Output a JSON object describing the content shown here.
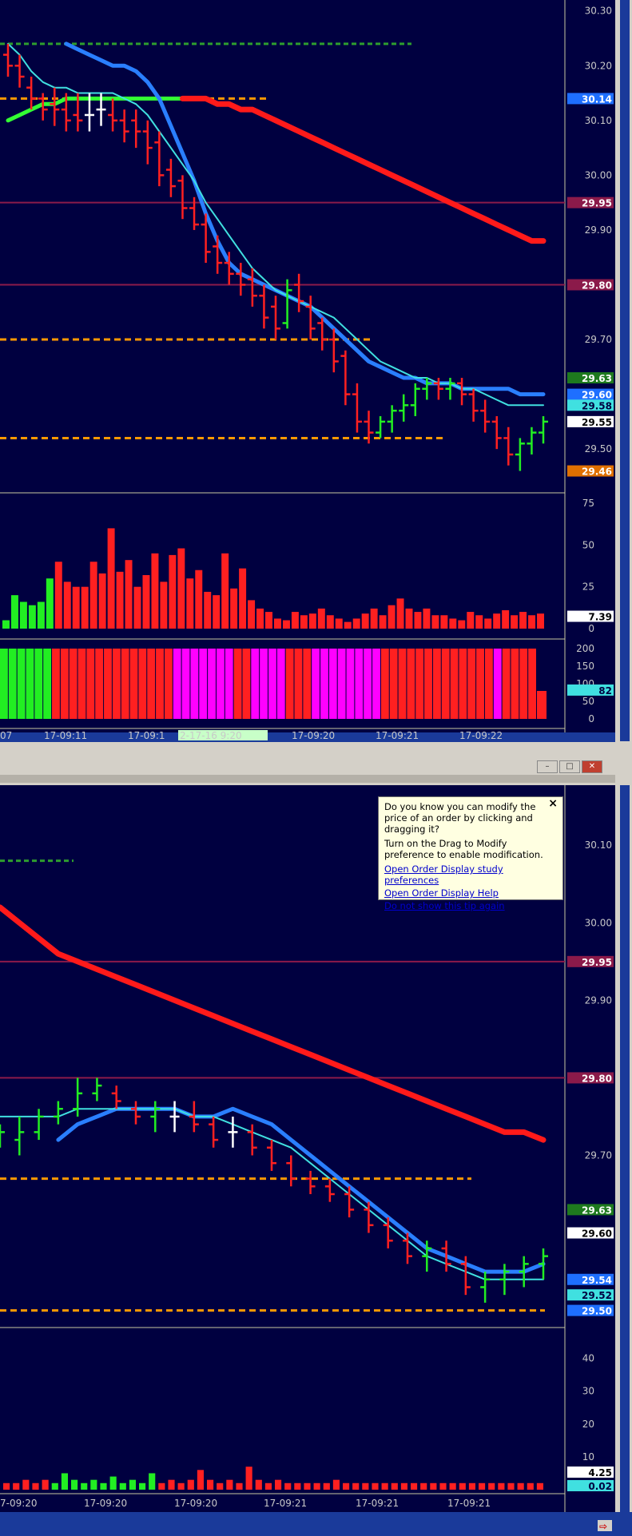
{
  "colors": {
    "background": "#000040",
    "up_bar": "#22ee22",
    "down_bar": "#ff2020",
    "doji_bar": "#ffffff",
    "ema_fast": "#40e0e0",
    "ema_slow": "#2a7fff",
    "ma_red": "#ff1a1a",
    "ma_green": "#33ff33",
    "level_line": "#8b1a4a",
    "order_line": "#ff9900",
    "target_line": "#2e9e2e",
    "magenta": "#ff00ff"
  },
  "top_chart": {
    "price_labels": [
      "30.30",
      "30.20",
      "30.10",
      "30.00",
      "29.90",
      "29.70",
      "29.50"
    ],
    "tags": [
      {
        "text": "30.14",
        "bg": "#1e6fff",
        "fg": "#ffffff"
      },
      {
        "text": "29.95",
        "bg": "#8b1a4a",
        "fg": "#ffffff"
      },
      {
        "text": "29.80",
        "bg": "#8b1a4a",
        "fg": "#ffffff"
      },
      {
        "text": "29.63",
        "bg": "#1e7a1e",
        "fg": "#ffffff"
      },
      {
        "text": "29.60",
        "bg": "#1e6fff",
        "fg": "#ffffff"
      },
      {
        "text": "29.58",
        "bg": "#40e0e0",
        "fg": "#000040"
      },
      {
        "text": "29.55",
        "bg": "#ffffff",
        "fg": "#000000"
      },
      {
        "text": "29.46",
        "bg": "#e07000",
        "fg": "#ffffff"
      }
    ],
    "volume_labels": [
      "75",
      "50",
      "25",
      "0"
    ],
    "volume_tag": "7.39",
    "indicator_labels": [
      "200",
      "150",
      "100",
      "50",
      "0"
    ],
    "indicator_tag": "82",
    "time_labels": [
      "07",
      "17-09:11",
      "17-09:1",
      "2-17-16  9:20",
      "17-09:20",
      "17-09:21",
      "17-09:22"
    ]
  },
  "bottom_chart": {
    "price_labels": [
      "30.10",
      "30.00",
      "29.90",
      "29.70"
    ],
    "tags": [
      {
        "text": "29.95",
        "bg": "#8b1a4a",
        "fg": "#ffffff"
      },
      {
        "text": "29.80",
        "bg": "#8b1a4a",
        "fg": "#ffffff"
      },
      {
        "text": "29.63",
        "bg": "#1e7a1e",
        "fg": "#ffffff"
      },
      {
        "text": "29.60",
        "bg": "#ffffff",
        "fg": "#000000"
      },
      {
        "text": "29.54",
        "bg": "#1e6fff",
        "fg": "#ffffff"
      },
      {
        "text": "29.52",
        "bg": "#40e0e0",
        "fg": "#000040"
      },
      {
        "text": "29.50",
        "bg": "#1e6fff",
        "fg": "#ffffff"
      }
    ],
    "volume_labels": [
      "40",
      "30",
      "20",
      "10"
    ],
    "volume_tags": [
      "4.25",
      "0.02"
    ],
    "time_labels": [
      "7-09:20",
      "17-09:20",
      "17-09:20",
      "17-09:21",
      "17-09:21",
      "17-09:21"
    ]
  },
  "tooltip": {
    "close": "×",
    "text1": "Do you know you can modify the price of an order by clicking and dragging it?",
    "text2": "Turn on the Drag to Modify preference to enable modification.",
    "link1": "Open Order Display study preferences",
    "link2": "Open Order Display Help",
    "link3": "Do not show this tip again"
  },
  "window_buttons": [
    "–",
    "□",
    "✕"
  ],
  "chart_data": [
    {
      "type": "bar",
      "title": "",
      "ylim": [
        29.42,
        30.32
      ],
      "series": [
        {
          "ohlc": [
            [
              30.22,
              30.24,
              30.18,
              30.2
            ],
            [
              30.2,
              30.22,
              30.16,
              30.18
            ],
            [
              30.16,
              30.18,
              30.12,
              30.14
            ],
            [
              30.14,
              30.15,
              30.1,
              30.12
            ],
            [
              30.13,
              30.16,
              30.09,
              30.12
            ],
            [
              30.12,
              30.15,
              30.08,
              30.1
            ],
            [
              30.11,
              30.15,
              30.08,
              30.1
            ],
            [
              30.11,
              30.15,
              30.08,
              30.11
            ],
            [
              30.12,
              30.15,
              30.09,
              30.12
            ],
            [
              30.11,
              30.14,
              30.08,
              30.1
            ],
            [
              30.1,
              30.12,
              30.06,
              30.08
            ],
            [
              30.1,
              30.12,
              30.05,
              30.08
            ],
            [
              30.08,
              30.1,
              30.02,
              30.05
            ],
            [
              30.06,
              30.08,
              29.98,
              30.0
            ],
            [
              30.01,
              30.03,
              29.96,
              29.98
            ],
            [
              29.99,
              30.0,
              29.92,
              29.94
            ],
            [
              29.94,
              29.96,
              29.9,
              29.91
            ],
            [
              29.91,
              29.93,
              29.84,
              29.86
            ],
            [
              29.87,
              29.89,
              29.82,
              29.84
            ],
            [
              29.84,
              29.86,
              29.8,
              29.82
            ],
            [
              29.82,
              29.84,
              29.78,
              29.8
            ],
            [
              29.81,
              29.83,
              29.76,
              29.78
            ],
            [
              29.78,
              29.8,
              29.72,
              29.74
            ],
            [
              29.76,
              29.78,
              29.7,
              29.72
            ],
            [
              29.73,
              29.81,
              29.72,
              29.79
            ],
            [
              29.8,
              29.82,
              29.75,
              29.77
            ],
            [
              29.76,
              29.78,
              29.7,
              29.72
            ],
            [
              29.73,
              29.74,
              29.68,
              29.7
            ],
            [
              29.7,
              29.72,
              29.64,
              29.66
            ],
            [
              29.67,
              29.68,
              29.58,
              29.6
            ],
            [
              29.6,
              29.62,
              29.53,
              29.55
            ],
            [
              29.55,
              29.57,
              29.51,
              29.53
            ],
            [
              29.53,
              29.56,
              29.52,
              29.55
            ],
            [
              29.55,
              29.58,
              29.53,
              29.57
            ],
            [
              29.57,
              29.6,
              29.55,
              29.58
            ],
            [
              29.58,
              29.62,
              29.56,
              29.61
            ],
            [
              29.61,
              29.63,
              29.59,
              29.62
            ],
            [
              29.62,
              29.63,
              29.59,
              29.61
            ],
            [
              29.61,
              29.63,
              29.59,
              29.62
            ],
            [
              29.62,
              29.63,
              29.58,
              29.6
            ],
            [
              29.6,
              29.61,
              29.55,
              29.57
            ],
            [
              29.57,
              29.59,
              29.53,
              29.55
            ],
            [
              29.55,
              29.56,
              29.5,
              29.52
            ],
            [
              29.52,
              29.54,
              29.47,
              29.49
            ],
            [
              29.49,
              29.52,
              29.46,
              29.51
            ],
            [
              29.51,
              29.54,
              29.49,
              29.53
            ],
            [
              29.53,
              29.56,
              29.51,
              29.55
            ]
          ],
          "ema_fast": [
            30.24,
            30.22,
            30.19,
            30.17,
            30.16,
            30.16,
            30.15,
            30.15,
            30.15,
            30.15,
            30.14,
            30.13,
            30.11,
            30.08,
            30.05,
            30.02,
            29.99,
            29.95,
            29.92,
            29.89,
            29.86,
            29.83,
            29.81,
            29.79,
            29.78,
            29.77,
            29.76,
            29.75,
            29.74,
            29.72,
            29.7,
            29.68,
            29.66,
            29.65,
            29.64,
            29.63,
            29.63,
            29.62,
            29.62,
            29.61,
            29.61,
            29.6,
            29.59,
            29.58,
            29.58,
            29.58,
            29.58
          ],
          "ema_slow": [
            null,
            null,
            null,
            null,
            null,
            30.24,
            30.23,
            30.22,
            30.21,
            30.2,
            30.2,
            30.19,
            30.17,
            30.14,
            30.09,
            30.04,
            29.99,
            29.93,
            29.88,
            29.84,
            29.82,
            29.81,
            29.8,
            29.79,
            29.78,
            29.77,
            29.76,
            29.74,
            29.72,
            29.7,
            29.68,
            29.66,
            29.65,
            29.64,
            29.63,
            29.63,
            29.62,
            29.62,
            29.62,
            29.61,
            29.61,
            29.61,
            29.61,
            29.61,
            29.6,
            29.6,
            29.6
          ],
          "ma_red": [
            null,
            null,
            null,
            null,
            null,
            null,
            null,
            null,
            null,
            null,
            null,
            null,
            null,
            null,
            null,
            30.14,
            30.14,
            30.14,
            30.13,
            30.13,
            30.12,
            30.12,
            30.11,
            30.1,
            30.09,
            30.08,
            30.07,
            30.06,
            30.05,
            30.04,
            30.03,
            30.02,
            30.01,
            30.0,
            29.99,
            29.98,
            29.97,
            29.96,
            29.95,
            29.94,
            29.93,
            29.92,
            29.91,
            29.9,
            29.89,
            29.88,
            29.88
          ],
          "ma_green": [
            30.1,
            30.11,
            30.12,
            30.13,
            30.13,
            30.14,
            30.14,
            30.14,
            30.14,
            30.14,
            30.14,
            30.14,
            30.14,
            30.14,
            30.14,
            30.14
          ]
        }
      ],
      "volume": [
        5,
        20,
        16,
        14,
        16,
        30,
        40,
        28,
        25,
        25,
        40,
        33,
        60,
        34,
        41,
        25,
        32,
        45,
        28,
        44,
        48,
        30,
        35,
        22,
        20,
        45,
        24,
        36,
        17,
        12,
        10,
        6,
        5,
        10,
        8,
        9,
        12,
        8,
        6,
        4,
        6,
        9,
        12,
        8,
        14,
        18,
        12,
        10,
        12,
        8,
        8,
        6,
        5,
        10,
        8,
        6,
        9,
        11,
        8,
        10,
        8,
        9
      ],
      "indicator_colors": [
        "g",
        "g",
        "g",
        "g",
        "g",
        "g",
        "r",
        "r",
        "r",
        "r",
        "r",
        "r",
        "r",
        "r",
        "r",
        "r",
        "r",
        "r",
        "r",
        "r",
        "m",
        "m",
        "m",
        "m",
        "m",
        "m",
        "m",
        "r",
        "r",
        "m",
        "m",
        "m",
        "m",
        "r",
        "r",
        "r",
        "m",
        "m",
        "m",
        "m",
        "m",
        "m",
        "m",
        "m",
        "r",
        "r",
        "r",
        "r",
        "r",
        "r",
        "r",
        "r",
        "r",
        "r",
        "r",
        "r",
        "r",
        "m",
        "r",
        "r",
        "r",
        "r"
      ]
    },
    {
      "type": "bar",
      "title": "",
      "ylim": [
        29.48,
        30.16
      ],
      "series": [
        {
          "ohlc": [
            [
              29.72,
              29.74,
              29.71,
              29.73
            ],
            [
              29.72,
              29.75,
              29.7,
              29.73
            ],
            [
              29.73,
              29.76,
              29.72,
              29.75
            ],
            [
              29.75,
              29.77,
              29.74,
              29.76
            ],
            [
              29.76,
              29.8,
              29.75,
              29.78
            ],
            [
              29.78,
              29.8,
              29.77,
              29.79
            ],
            [
              29.78,
              29.79,
              29.76,
              29.77
            ],
            [
              29.76,
              29.77,
              29.74,
              29.75
            ],
            [
              29.75,
              29.77,
              29.73,
              29.76
            ],
            [
              29.75,
              29.77,
              29.73,
              29.75
            ],
            [
              29.75,
              29.77,
              29.73,
              29.74
            ],
            [
              29.74,
              29.75,
              29.71,
              29.72
            ],
            [
              29.73,
              29.75,
              29.71,
              29.73
            ],
            [
              29.73,
              29.74,
              29.7,
              29.71
            ],
            [
              29.71,
              29.72,
              29.68,
              29.69
            ],
            [
              29.69,
              29.7,
              29.66,
              29.67
            ],
            [
              29.67,
              29.68,
              29.65,
              29.66
            ],
            [
              29.66,
              29.67,
              29.64,
              29.65
            ],
            [
              29.65,
              29.66,
              29.62,
              29.63
            ],
            [
              29.63,
              29.64,
              29.6,
              29.61
            ],
            [
              29.61,
              29.62,
              29.58,
              29.59
            ],
            [
              29.59,
              29.6,
              29.56,
              29.57
            ],
            [
              29.57,
              29.59,
              29.55,
              29.58
            ],
            [
              29.58,
              29.59,
              29.55,
              29.56
            ],
            [
              29.56,
              29.57,
              29.52,
              29.53
            ],
            [
              29.53,
              29.55,
              29.51,
              29.54
            ],
            [
              29.54,
              29.56,
              29.52,
              29.55
            ],
            [
              29.55,
              29.57,
              29.53,
              29.56
            ],
            [
              29.56,
              29.58,
              29.54,
              29.57
            ]
          ],
          "ema_fast": [
            29.75,
            29.75,
            29.75,
            29.75,
            29.76,
            29.76,
            29.76,
            29.76,
            29.76,
            29.76,
            29.75,
            29.75,
            29.74,
            29.73,
            29.72,
            29.71,
            29.69,
            29.67,
            29.65,
            29.63,
            29.61,
            29.59,
            29.57,
            29.56,
            29.55,
            29.54,
            29.54,
            29.54,
            29.54
          ],
          "ema_slow": [
            null,
            null,
            null,
            29.72,
            29.74,
            29.75,
            29.76,
            29.76,
            29.76,
            29.76,
            29.75,
            29.75,
            29.76,
            29.75,
            29.74,
            29.72,
            29.7,
            29.68,
            29.66,
            29.64,
            29.62,
            29.6,
            29.58,
            29.57,
            29.56,
            29.55,
            29.55,
            29.55,
            29.56
          ],
          "ma_red": [
            30.02,
            30.0,
            29.98,
            29.96,
            29.95,
            29.94,
            29.93,
            29.92,
            29.91,
            29.9,
            29.89,
            29.88,
            29.87,
            29.86,
            29.85,
            29.84,
            29.83,
            29.82,
            29.81,
            29.8,
            29.79,
            29.78,
            29.77,
            29.76,
            29.75,
            29.74,
            29.73,
            29.73,
            29.72
          ]
        }
      ],
      "volume": [
        2,
        2,
        3,
        2,
        3,
        2,
        5,
        3,
        2,
        3,
        2,
        4,
        2,
        3,
        2,
        5,
        2,
        3,
        2,
        3,
        6,
        3,
        2,
        3,
        2,
        7,
        3,
        2,
        3,
        2,
        2,
        2,
        2,
        2,
        3,
        2,
        2,
        2,
        2,
        2,
        2,
        2,
        2,
        2,
        2,
        2,
        2,
        2,
        2,
        2,
        2,
        2,
        2,
        2,
        2,
        2
      ]
    }
  ]
}
